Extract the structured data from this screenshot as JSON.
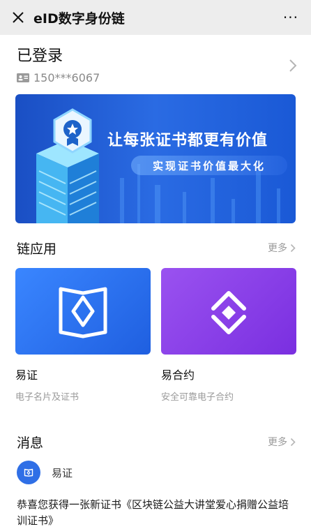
{
  "nav": {
    "title": "eID数字身份链",
    "more": "···"
  },
  "login": {
    "status": "已登录",
    "phone": "150***6067"
  },
  "banner": {
    "headline": "让每张证书都更有价值",
    "subline": "实现证书价值最大化"
  },
  "apps_section": {
    "title": "链应用",
    "more": "更多",
    "items": [
      {
        "name": "易证",
        "desc": "电子名片及证书",
        "color": "#2b6ff0"
      },
      {
        "name": "易合约",
        "desc": "安全可靠电子合约",
        "color": "#8a3fe6"
      }
    ]
  },
  "messages_section": {
    "title": "消息",
    "more": "更多",
    "item": {
      "sender": "易证",
      "text": "恭喜您获得一张新证书《区块链公益大讲堂爱心捐赠公益培训证书》"
    }
  }
}
